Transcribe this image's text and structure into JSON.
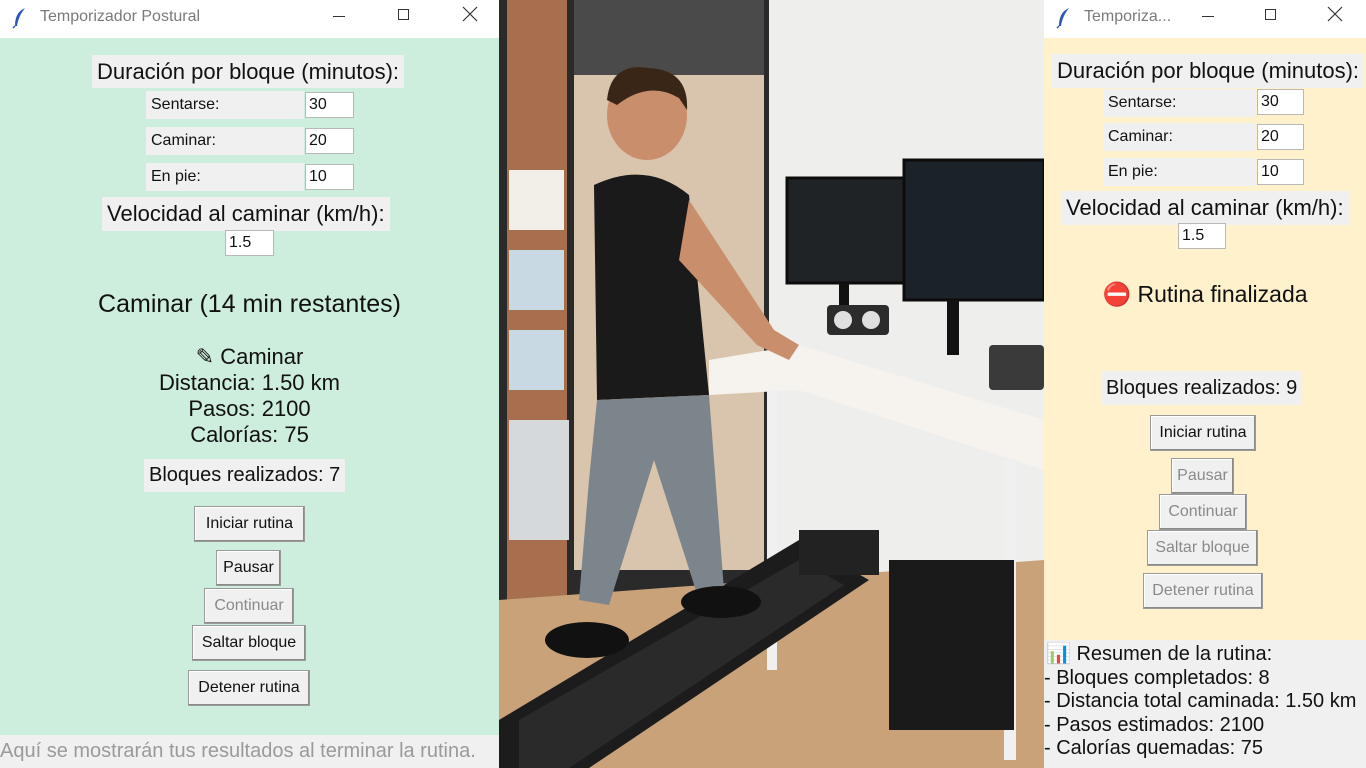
{
  "left_window": {
    "title": "Temporizador Postural",
    "duration_header": "Duración por bloque (minutos):",
    "sit_label": "Sentarse:",
    "sit_value": "30",
    "walk_label": "Caminar:",
    "walk_value": "20",
    "stand_label": "En pie:",
    "stand_value": "10",
    "speed_header": "Velocidad al caminar (km/h):",
    "speed_value": "1.5",
    "status": "Caminar (14 min restantes)",
    "activity": "✎ Caminar",
    "distance": "Distancia: 1.50 km",
    "steps": "Pasos: 2100",
    "calories": "Calorías: 75",
    "blocks_done": "Bloques realizados: 7",
    "btn_start": "Iniciar rutina",
    "btn_pause": "Pausar",
    "btn_continue": "Continuar",
    "btn_skip": "Saltar bloque",
    "btn_stop": "Detener rutina",
    "footer": "Aquí se mostrarán tus resultados al terminar la rutina."
  },
  "right_window": {
    "title": "Temporiza...",
    "duration_header": "Duración por bloque (minutos):",
    "sit_label": "Sentarse:",
    "sit_value": "30",
    "walk_label": "Caminar:",
    "walk_value": "20",
    "stand_label": "En pie:",
    "stand_value": "10",
    "speed_header": "Velocidad al caminar (km/h):",
    "speed_value": "1.5",
    "status_icon": "⛔",
    "status": "Rutina finalizada",
    "blocks_done": "Bloques realizados: 9",
    "btn_start": "Iniciar rutina",
    "btn_pause": "Pausar",
    "btn_continue": "Continuar",
    "btn_skip": "Saltar bloque",
    "btn_stop": "Detener rutina",
    "summary_title": "📊 Resumen de la rutina:",
    "summary_blocks": "- Bloques completados: 8",
    "summary_distance": "- Distancia total caminada: 1.50 km",
    "summary_steps": "- Pasos estimados: 2100",
    "summary_calories": "- Calorías quemadas: 75"
  },
  "colors": {
    "left_bg": "#cdeedd",
    "right_bg": "#fff1cc",
    "summary_bg": "#f0f0f0"
  }
}
